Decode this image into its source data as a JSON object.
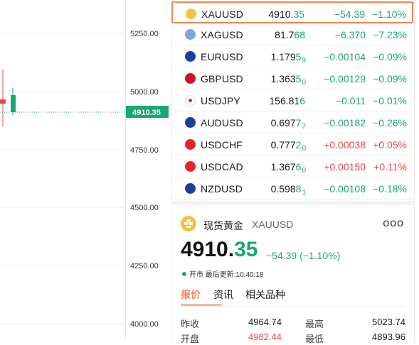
{
  "chart": {
    "axis_labels": [
      "5250.00",
      "5000.00",
      "4750.00",
      "4500.00",
      "4250.00",
      "4000.00"
    ],
    "current_price_label": "4910.35",
    "colors": {
      "up": "#e5474b",
      "down": "#1ba672",
      "grid": "#eeeeee",
      "price_tag": "#1ba672"
    }
  },
  "watchlist": [
    {
      "symbol": "XAUUSD",
      "price_main": "4910.",
      "price_tail": "35",
      "price_sub": "",
      "change": "−54.39",
      "pct": "−1.10%",
      "dir": "down",
      "icon": "gold-icon",
      "selected": true
    },
    {
      "symbol": "XAGUSD",
      "price_main": "81.7",
      "price_tail": "68",
      "price_sub": "",
      "change": "−6.370",
      "pct": "−7.23%",
      "dir": "down",
      "icon": "silver-icon",
      "selected": false
    },
    {
      "symbol": "EURUSD",
      "price_main": "1.179",
      "price_tail": "5",
      "price_sub": "9",
      "change": "−0.00104",
      "pct": "−0.09%",
      "dir": "down",
      "icon": "eu-flag-icon",
      "selected": false
    },
    {
      "symbol": "GBPUSD",
      "price_main": "1.363",
      "price_tail": "5",
      "price_sub": "0",
      "change": "−0.00129",
      "pct": "−0.09%",
      "dir": "down",
      "icon": "uk-flag-icon",
      "selected": false
    },
    {
      "symbol": "USDJPY",
      "price_main": "156.81",
      "price_tail": "6",
      "price_sub": "",
      "change": "−0.011",
      "pct": "−0.01%",
      "dir": "down",
      "icon": "jp-flag-icon",
      "selected": false
    },
    {
      "symbol": "AUDUSD",
      "price_main": "0.697",
      "price_tail": "7",
      "price_sub": "7",
      "change": "−0.00182",
      "pct": "−0.26%",
      "dir": "down",
      "icon": "au-flag-icon",
      "selected": false
    },
    {
      "symbol": "USDCHF",
      "price_main": "0.777",
      "price_tail": "2",
      "price_sub": "0",
      "change": "+0.00038",
      "pct": "+0.05%",
      "dir": "up",
      "icon": "ch-flag-icon",
      "selected": false
    },
    {
      "symbol": "USDCAD",
      "price_main": "1.367",
      "price_tail": "6",
      "price_sub": "0",
      "change": "+0.00150",
      "pct": "+0.11%",
      "dir": "up",
      "icon": "ca-flag-icon",
      "selected": false
    },
    {
      "symbol": "NZDUSD",
      "price_main": "0.598",
      "price_tail": "8",
      "price_sub": "1",
      "change": "−0.00108",
      "pct": "−0.18%",
      "dir": "down",
      "icon": "nz-flag-icon",
      "selected": false
    }
  ],
  "detail": {
    "name": "现货黄金",
    "code": "XAUUSD",
    "more": "ooo",
    "price_main": "4910.",
    "price_tail": "35",
    "change": "−54.39 (−1.10%)",
    "status": "开市",
    "updated": "最后更新:10:40:18",
    "tabs": [
      "报价",
      "资讯",
      "相关品种"
    ],
    "stats": [
      {
        "label": "昨收",
        "value": "4964.74",
        "label2": "最高",
        "value2": "5023.74",
        "color2": "up"
      },
      {
        "label": "开盘",
        "value": "4982.44",
        "label2": "最低",
        "value2": "4893.96",
        "color2": "down"
      }
    ]
  }
}
